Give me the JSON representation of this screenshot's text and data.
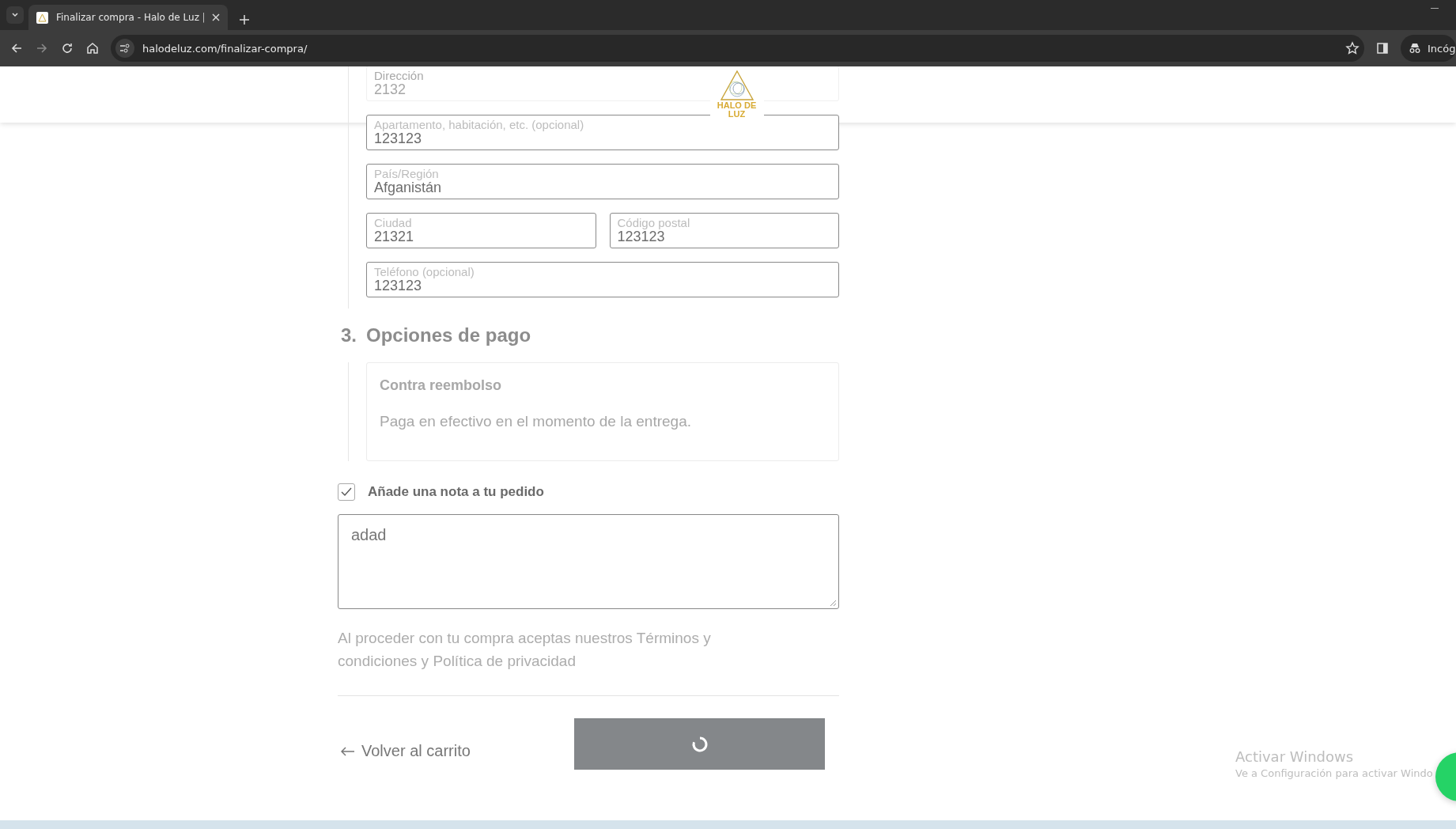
{
  "browser": {
    "tab_title": "Finalizar compra - Halo de Luz |",
    "url": "halodeluz.com/finalizar-compra/",
    "profile_label": "Incóg"
  },
  "header": {
    "logo_text": "HALO DE LUZ"
  },
  "address_fields": [
    {
      "label": "Dirección",
      "value": "2132",
      "kind": "full"
    },
    {
      "label": "Apartamento, habitación, etc. (opcional)",
      "value": "123123",
      "kind": "full"
    },
    {
      "label": "País/Región",
      "value": "Afganistán",
      "kind": "full"
    },
    {
      "label": "Ciudad",
      "value": "21321",
      "kind": "half"
    },
    {
      "label": "Código postal",
      "value": "123123",
      "kind": "half"
    },
    {
      "label": "Teléfono (opcional)",
      "value": "123123",
      "kind": "full"
    }
  ],
  "payment": {
    "step": "3.",
    "title": "Opciones de pago",
    "method": "Contra reembolso",
    "description": "Paga en efectivo en el momento de la entrega."
  },
  "note": {
    "checked": true,
    "label": "Añade una nota a tu pedido",
    "value": "adad"
  },
  "terms": "Al proceder con tu compra aceptas nuestros Términos y condiciones y Política de privacidad",
  "back_link": "Volver al carrito",
  "place_order": {
    "loading": true
  },
  "os_notice": {
    "title": "Activar Windows",
    "subtitle": "Ve a Configuración para activar Windo"
  }
}
